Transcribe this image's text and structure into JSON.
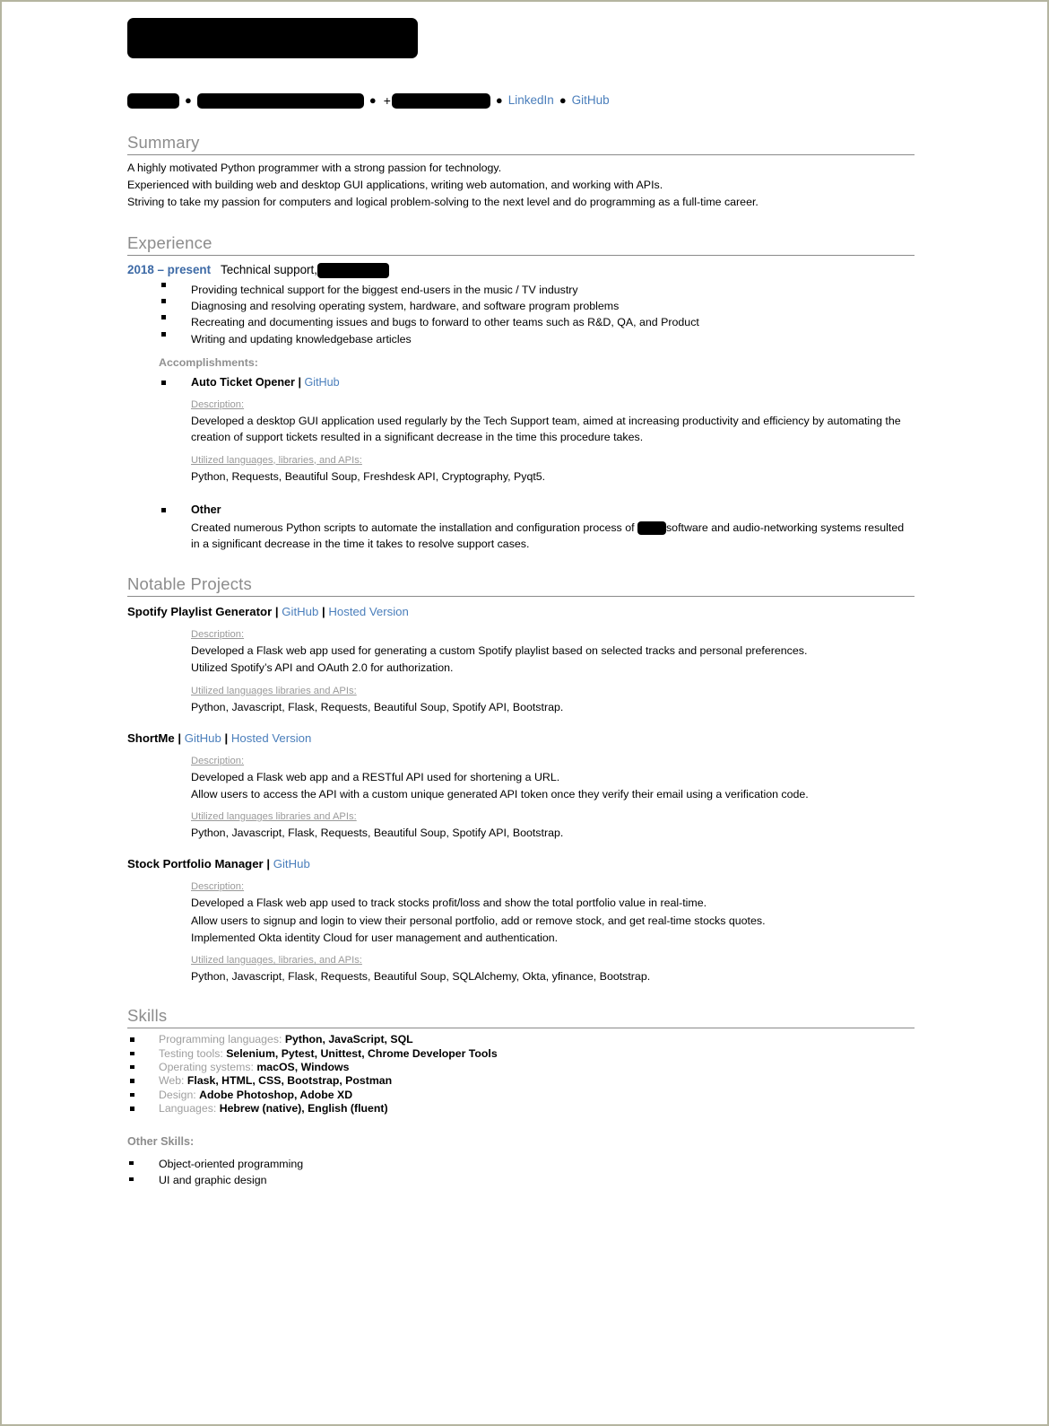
{
  "theme": {
    "link_color": "#4a7ebb",
    "heading_color": "#8c8c8c",
    "date_color": "#3d6aa6",
    "label_color": "#9a9a9a",
    "page_border": "#b5b5a0"
  },
  "header": {
    "name_redacted": true,
    "contact": {
      "location_redacted": true,
      "email_redacted": true,
      "phone_prefix": "+",
      "phone_redacted": true,
      "separator": "●",
      "links": [
        {
          "label": "LinkedIn"
        },
        {
          "label": "GitHub"
        }
      ]
    }
  },
  "sections": {
    "summary": {
      "title": "Summary",
      "lines": [
        "A highly motivated Python programmer with a strong passion for technology.",
        "Experienced with building web and desktop GUI applications, writing web automation, and working with APIs.",
        "Striving to take my passion for computers and logical problem-solving to the next level and do programming as a full-time career."
      ]
    },
    "experience": {
      "title": "Experience",
      "job": {
        "dates": "2018 – present",
        "title": "Technical support,",
        "company_redacted": true,
        "duties": [
          "Providing technical support for the biggest end-users in the music / TV industry",
          "Diagnosing and resolving operating system, hardware, and software program problems",
          "Recreating and documenting issues and bugs to forward to other teams such as R&D, QA, and Product",
          "Writing and updating knowledgebase articles"
        ],
        "accomplishments_label": "Accomplishments:",
        "accomplishments": [
          {
            "name": "Auto Ticket Opener",
            "divider": "|",
            "links": [
              {
                "label": "GitHub"
              }
            ],
            "description_label": "Description:",
            "description_lines": [
              "Developed a desktop GUI application used regularly by the Tech Support team, aimed at increasing productivity and efficiency by automating the creation of support tickets resulted in a significant decrease in the time this procedure takes."
            ],
            "tech_label": "Utilized languages, libraries, and APIs:",
            "tech_value": "Python, Requests, Beautiful Soup, Freshdesk API, Cryptography, Pyqt5."
          }
        ],
        "other": {
          "name": "Other",
          "text_before_redaction": "Created numerous Python scripts to automate the installation and configuration process of ",
          "text_after_redaction": "software and audio-networking systems resulted in a significant decrease in the time it takes to resolve support cases."
        }
      }
    },
    "projects": {
      "title": "Notable Projects",
      "items": [
        {
          "name": "Spotify Playlist Generator",
          "divider": "|",
          "links": [
            {
              "label": "GitHub"
            },
            {
              "label": "Hosted Version"
            }
          ],
          "description_label": "Description:",
          "description_lines": [
            "Developed a Flask web app used for generating a custom Spotify playlist based on selected tracks and personal preferences.",
            "Utilized Spotify’s API and OAuth 2.0 for authorization."
          ],
          "tech_label": "Utilized languages libraries and APIs:",
          "tech_value": "Python, Javascript, Flask, Requests, Beautiful Soup, Spotify API, Bootstrap."
        },
        {
          "name": "ShortMe",
          "divider": "|",
          "links": [
            {
              "label": "GitHub"
            },
            {
              "label": "Hosted Version"
            }
          ],
          "description_label": "Description:",
          "description_lines": [
            "Developed a Flask web app and a RESTful API used for shortening a URL.",
            "Allow users to access the API with a custom unique generated API token once they verify their email using a verification code."
          ],
          "tech_label": "Utilized languages libraries and APIs:",
          "tech_value": "Python, Javascript, Flask, Requests, Beautiful Soup, Spotify API, Bootstrap."
        },
        {
          "name": "Stock Portfolio Manager",
          "divider": "|",
          "links": [
            {
              "label": "GitHub"
            }
          ],
          "description_label": "Description:",
          "description_lines": [
            "Developed a Flask web app used to track stocks profit/loss and show the total portfolio value in real-time.",
            "Allow users to signup and login to view their personal portfolio, add or remove stock, and get real-time stocks quotes.",
            "Implemented Okta identity Cloud for user management and authentication."
          ],
          "tech_label": "Utilized languages, libraries, and APIs:",
          "tech_value": "Python, Javascript, Flask, Requests, Beautiful Soup, SQLAlchemy, Okta, yfinance, Bootstrap."
        }
      ]
    },
    "skills": {
      "title": "Skills",
      "items": [
        {
          "label": "Programming languages:",
          "value": "Python, JavaScript, SQL"
        },
        {
          "label": "Testing tools:",
          "value": "Selenium, Pytest, Unittest, Chrome Developer Tools"
        },
        {
          "label": "Operating systems:",
          "value": "macOS, Windows"
        },
        {
          "label": "Web:",
          "value": "Flask, HTML, CSS, Bootstrap, Postman"
        },
        {
          "label": "Design:",
          "value": "Adobe Photoshop, Adobe XD"
        },
        {
          "label": "Languages:",
          "value": "Hebrew (native), English (fluent)"
        }
      ],
      "other_label": "Other Skills:",
      "other_items": [
        "Object-oriented programming",
        "UI and graphic design"
      ]
    }
  }
}
